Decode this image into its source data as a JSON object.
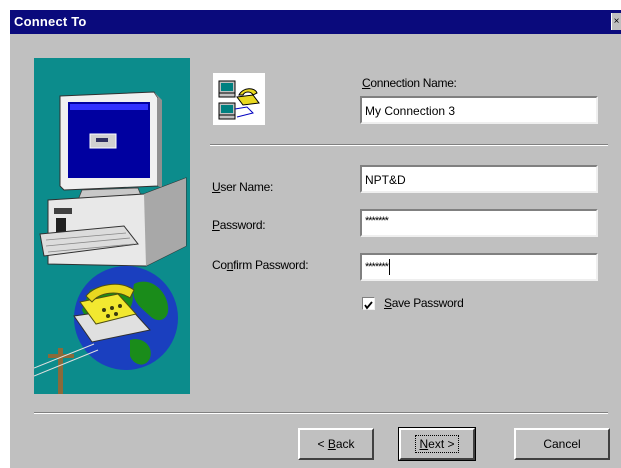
{
  "window": {
    "title": "Connect To",
    "close_glyph": "×"
  },
  "icons": {
    "wizard_image": "computer-phone-globe-illustration",
    "connection": "dial-up-networking-icon",
    "checkmark": "checkmark-icon"
  },
  "form": {
    "connection_name": {
      "label_accel": "C",
      "label_rest": "onnection Name:",
      "value": "My Connection 3"
    },
    "user_name": {
      "label_accel": "U",
      "label_rest": "ser Name:",
      "value": "NPT&D"
    },
    "password": {
      "label_accel": "P",
      "label_rest": "assword:",
      "value": "*******"
    },
    "confirm_password": {
      "label_pre": "Co",
      "label_accel": "n",
      "label_rest": "firm Password:",
      "value": "*******"
    },
    "save_password": {
      "label_accel": "S",
      "label_rest": "ave Password",
      "checked": true
    }
  },
  "buttons": {
    "back": {
      "pre": "< ",
      "accel": "B",
      "rest": "ack"
    },
    "next": {
      "accel": "N",
      "rest": "ext >"
    },
    "cancel": {
      "label": "Cancel"
    }
  },
  "colors": {
    "titlebar": "#0a0a7c",
    "dialog_face": "#c0c0c0",
    "wizard_background": "#0c8c8c"
  }
}
